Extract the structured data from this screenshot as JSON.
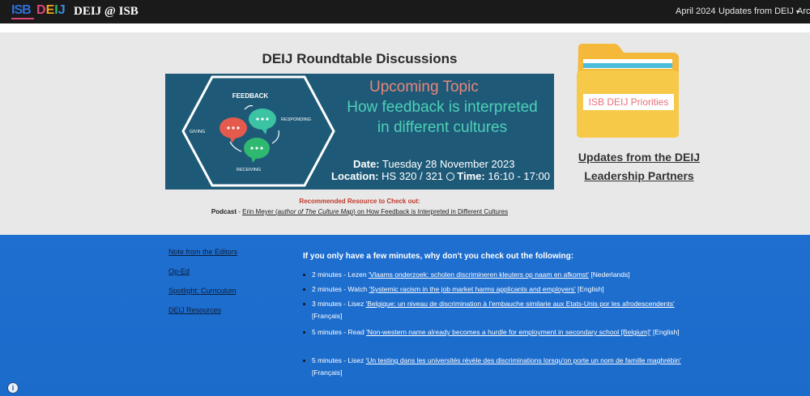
{
  "header": {
    "logo": {
      "isb": "ISB",
      "deij": [
        "D",
        "E",
        "I",
        "J"
      ]
    },
    "site_title": "DEIJ @ ISB",
    "nav": [
      {
        "label": "April 2024"
      },
      {
        "label": "Updates from DEIJ",
        "caret": "▾"
      },
      {
        "label": "Arch"
      }
    ]
  },
  "roundtable": {
    "title": "DEIJ Roundtable Discussions",
    "banner": {
      "diagram": {
        "center": "FEEDBACK",
        "left": "GIVING",
        "right": "RESPONDING",
        "bottom": "RECEIVING"
      },
      "upcoming": "Upcoming Topic",
      "topic": "How feedback is interpreted in different cultures",
      "date_label": "Date:",
      "date_value": "Tuesday 28 November 2023",
      "location_label": "Location:",
      "location_value": "HS 320 / 321",
      "time_label": "Time:",
      "time_value": "16:10 - 17:00"
    },
    "recommended_heading": "Recommended Resource to Check out:",
    "recommended": {
      "prefix": "Podcast",
      "separator": " - ",
      "link_start": "Erin Meyer (",
      "link_italic": "author of The Culture Map",
      "link_end": ") on How Feedback is Interpreted in Different Cultures"
    }
  },
  "priorities": {
    "folder_label": "ISB DEIJ Priorities",
    "updates_link": "Updates from the DEIJ Leadership Partners"
  },
  "sidebar": {
    "links": [
      "Note from the Editors",
      "Op-Ed",
      "Spotlight: Curriculum",
      "DEIJ Resources"
    ]
  },
  "minutes": {
    "heading": "If you only have a few minutes, why don't you check out the following:",
    "items": [
      {
        "time": "2 minutes",
        "verb": "Lezen",
        "link": "'Vlaams onderzoek: scholen discrimineren kleuters op naam en afkomst'",
        "lang": "[Nederlands]"
      },
      {
        "time": "2 minutes",
        "verb": "Watch",
        "link": "'Systemic racism in the job market harms applicants and employers'",
        "lang": "[English]"
      },
      {
        "time": "3 minutes",
        "verb": "Lisez",
        "link": "'Belgique: un niveau de discrimination à l'embauche similarie aux Etats-Unis por les afrodescendents'",
        "lang": "[Français]"
      },
      {
        "time": "5 minutes",
        "verb": "Read",
        "link": "'Non-western name already becomes a hurdle for employment in secondary school [Belgium]'",
        "lang": "[English]"
      },
      {
        "time": "5 minutes",
        "verb": "Lisez",
        "link": "'Un testing dans les universités révèle des discriminations lorsqu'on porte un nom de famille maghrébin'",
        "lang": "[Français]"
      }
    ]
  },
  "footer": {
    "info_glyph": "i"
  },
  "colors": {
    "topbar": "#1a1a1a",
    "gray_section": "#e8e8e8",
    "banner": "#1e5a78",
    "blue_section": "#1f6fd0",
    "folder": "#f7c948",
    "accent_red": "#c0392b",
    "teal": "#4ed0b6",
    "salmon": "#e8867a"
  }
}
